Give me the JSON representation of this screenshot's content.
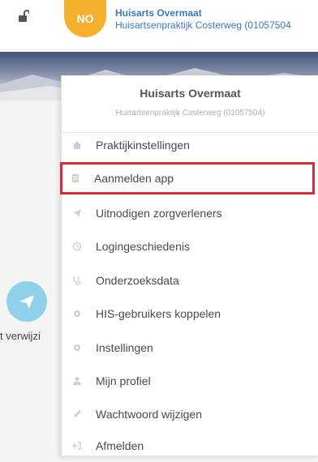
{
  "header": {
    "badge_initials": "NO",
    "practice_name": "Huisarts Overmaat",
    "practice_subtitle": "Huisartsenpraktijk Costerweg (01057504"
  },
  "side_action": {
    "label": "t verwijzi",
    "icon": "send-icon"
  },
  "dropdown": {
    "title": "Huisarts Overmaat",
    "subtitle": "Huisartsenpraktijk Costerweg (01057504)",
    "items": [
      {
        "label": "Praktijkinstellingen",
        "icon": "home-icon"
      },
      {
        "label": "Aanmelden app",
        "icon": "document-icon",
        "highlighted": true
      },
      {
        "label": "Uitnodigen zorgverleners",
        "icon": "send-icon"
      },
      {
        "label": "Logingeschiedenis",
        "icon": "history-icon"
      },
      {
        "label": "Onderzoeksdata",
        "icon": "stethoscope-icon"
      },
      {
        "label": "HIS-gebruikers koppelen",
        "icon": "gear-icon"
      },
      {
        "label": "Instellingen",
        "icon": "gear-icon"
      },
      {
        "label": "Mijn profiel",
        "icon": "user-icon"
      },
      {
        "label": "Wachtwoord wijzigen",
        "icon": "pencil-icon"
      },
      {
        "label": "Afmelden",
        "icon": "logout-icon"
      }
    ]
  },
  "colors": {
    "accent_blue": "#3a78c9",
    "badge_orange": "#f5b12e",
    "highlight_red": "#d82c36"
  }
}
